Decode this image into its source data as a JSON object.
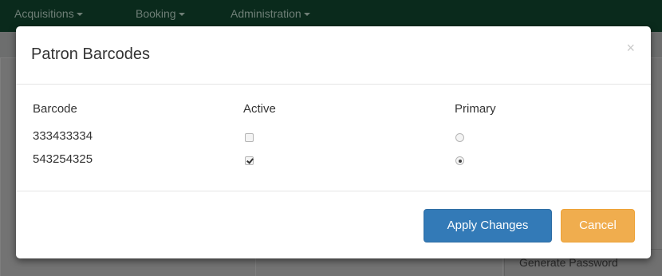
{
  "navbar": {
    "items": [
      {
        "label": "Acquisitions"
      },
      {
        "label": "Booking"
      },
      {
        "label": "Administration"
      }
    ]
  },
  "background": {
    "generate_password_label": "Generate Password"
  },
  "modal": {
    "title": "Patron Barcodes",
    "close_symbol": "×",
    "columns": {
      "barcode": "Barcode",
      "active": "Active",
      "primary": "Primary"
    },
    "rows": [
      {
        "barcode": "333433334",
        "active": false,
        "primary": false
      },
      {
        "barcode": "543254325",
        "active": true,
        "primary": true
      }
    ],
    "buttons": {
      "apply": "Apply Changes",
      "cancel": "Cancel"
    }
  },
  "colors": {
    "navbar": "#0a2a1c",
    "primary_button": "#337ab7",
    "warning_button": "#f0ad4e"
  }
}
